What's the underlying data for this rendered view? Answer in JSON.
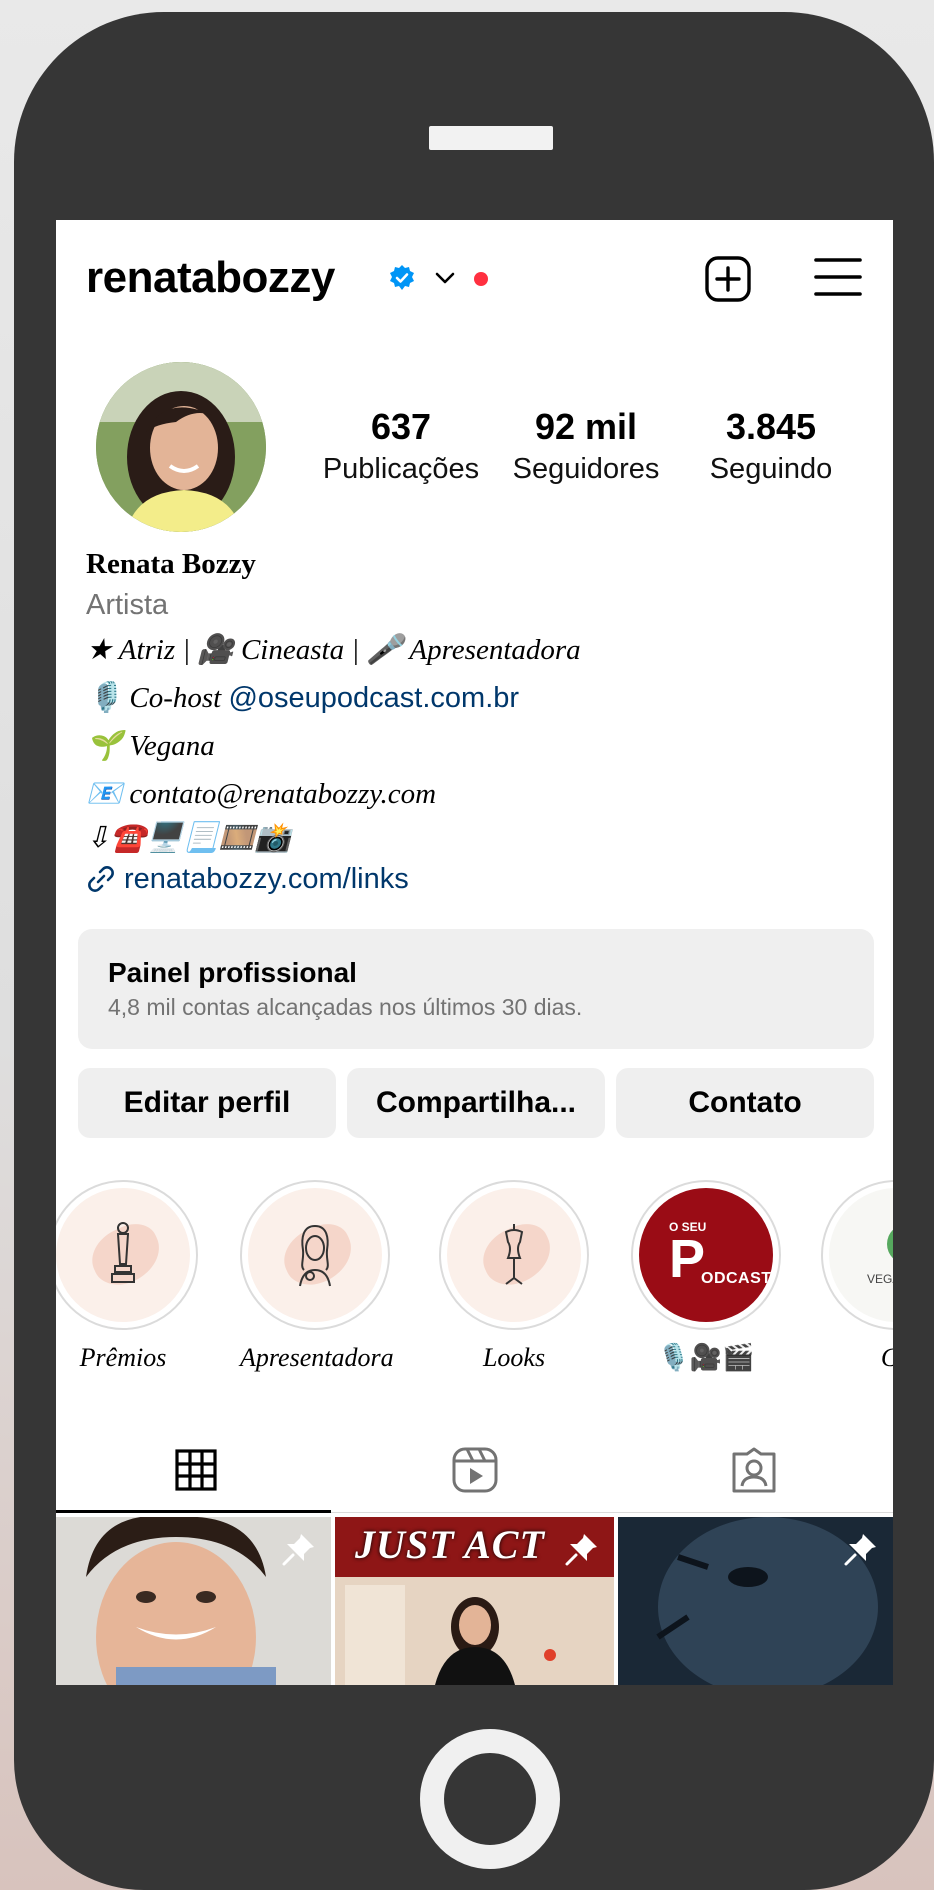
{
  "header": {
    "username": "renatabozzy"
  },
  "stats": [
    {
      "value": "637",
      "label": "Publicações"
    },
    {
      "value": "92 mil",
      "label": "Seguidores"
    },
    {
      "value": "3.845",
      "label": "Seguindo"
    }
  ],
  "bio": {
    "name": "Renata Bozzy",
    "category": "Artista",
    "line1": "★ Atriz | 🎥 Cineasta | 🎤 Apresentadora",
    "line2_prefix": "🎙️ Co-host ",
    "line2_mention": "@oseupodcast.com.br",
    "line3": "🌱 Vegana",
    "line4": "📧 contato@renatabozzy.com",
    "line5": "⇩☎️🖥️📃🎞️📸",
    "link": "renatabozzy.com/links"
  },
  "panel": {
    "title": "Painel profissional",
    "subtitle": "4,8 mil contas alcançadas nos últimos 30 dias."
  },
  "buttons": {
    "edit": "Editar perfil",
    "share": "Compartilha...",
    "contact": "Contato"
  },
  "highlights": [
    {
      "label": "Prêmios",
      "icon": "trophy-icon"
    },
    {
      "label": "Apresentadora",
      "icon": "presenter-icon"
    },
    {
      "label": "Looks",
      "icon": "dress-form-icon"
    },
    {
      "label": "🎙️🎥🎬",
      "icon": "podcast-cover",
      "cover_small": "O SEU",
      "cover_big": "P",
      "cover_word": "ODCAST"
    },
    {
      "label": "Co",
      "icon": "vegan-cover",
      "cover_text": "VEGA"
    }
  ],
  "posts": [
    {
      "overlay": ""
    },
    {
      "overlay": "JUST ACT"
    },
    {
      "overlay": ""
    }
  ],
  "colors": {
    "accent_link": "#00376b",
    "verified": "#0095f6",
    "notification_dot": "#ff3040",
    "podcast_red": "#9a0c15"
  }
}
